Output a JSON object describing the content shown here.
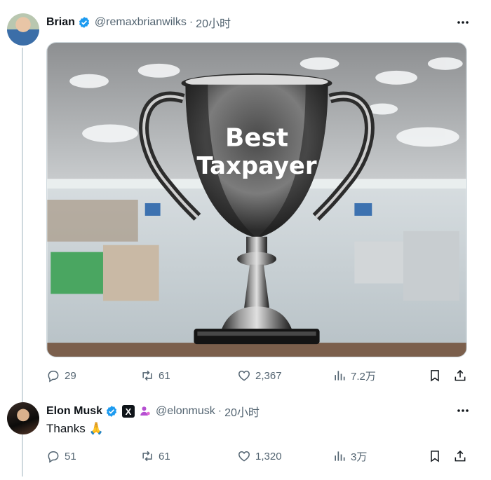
{
  "tweets": [
    {
      "author": {
        "name": "Brian",
        "handle": "@remaxbrianwilks",
        "time": "20小时"
      },
      "image": {
        "trophy_text_line1": "Best",
        "trophy_text_line2": "Taxpayer"
      },
      "stats": {
        "replies": "29",
        "retweets": "61",
        "likes": "2,367",
        "views": "7.2万"
      }
    },
    {
      "author": {
        "name": "Elon Musk",
        "handle": "@elonmusk",
        "time": "20小时"
      },
      "text": "Thanks 🙏",
      "stats": {
        "replies": "51",
        "retweets": "61",
        "likes": "1,320",
        "views": "3万"
      }
    }
  ],
  "colors": {
    "verified": "#1d9bf0",
    "muted": "#536471",
    "thread_line": "#cfd9de"
  },
  "icons": [
    "reply-icon",
    "retweet-icon",
    "like-icon",
    "views-icon",
    "bookmark-icon",
    "share-icon",
    "more-icon",
    "verified-icon"
  ]
}
